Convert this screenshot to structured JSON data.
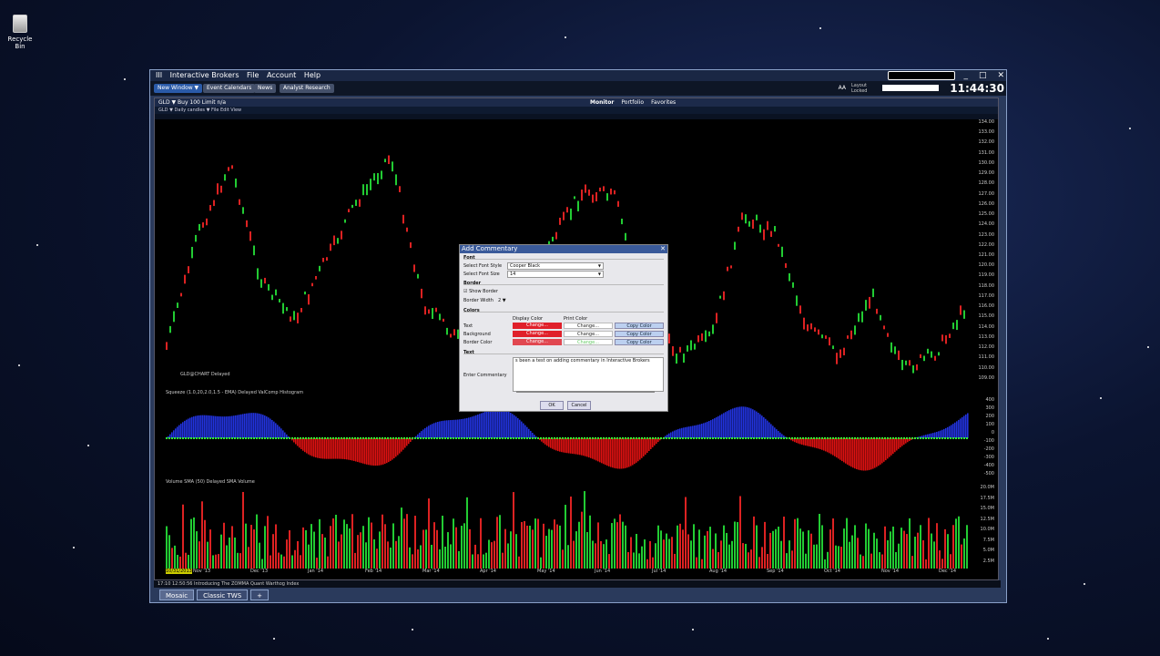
{
  "desktop": {
    "recycle_label": "Recycle Bin"
  },
  "app": {
    "title": "Interactive Brokers",
    "menu": [
      "File",
      "Account",
      "Help"
    ],
    "toolbar_buttons": [
      "New Window ▼",
      "Event Calendars",
      "News",
      "Analyst Research"
    ],
    "aa_label": "AA",
    "layout_lock": "Layout Locked",
    "clock": "11:44:30"
  },
  "chart": {
    "symbol_header": "GLD ▼    Buy 100 Limit n/a",
    "sub_header": "GLD ▼   Daily candles ▼   File   Edit   View",
    "monitor_tabs": [
      "Monitor",
      "Portfolio",
      "Favorites"
    ],
    "gld_label": "GLD@CHART Delayed",
    "osc_header": "Squeeze   (1.0,20,2.0,1.5 - EMA) Delayed     ValComp     Histogram",
    "vol_header": "Volume SMA   (50) Delayed     SMA     Volume",
    "price_ticks": [
      "134.00",
      "133.00",
      "132.00",
      "131.00",
      "130.00",
      "129.00",
      "128.00",
      "127.00",
      "126.00",
      "125.00",
      "124.00",
      "123.00",
      "122.00",
      "121.00",
      "120.00",
      "119.00",
      "118.00",
      "117.00",
      "116.00",
      "115.00",
      "114.00",
      "113.00",
      "112.00",
      "111.00",
      "110.00",
      "109.00"
    ],
    "osc_ticks": [
      "400",
      "300",
      "200",
      "100",
      "0",
      "-100",
      "-200",
      "-300",
      "-400",
      "-500"
    ],
    "vol_ticks": [
      "20.0M",
      "17.5M",
      "15.0M",
      "12.5M",
      "10.0M",
      "7.5M",
      "5.0M",
      "2.5M"
    ],
    "date_ticks": [
      "Nov '13",
      "Dec '13",
      "Jan '14",
      "Feb '14",
      "Mar '14",
      "Apr '14",
      "May '14",
      "Jun '14",
      "Jul '14",
      "Aug '14",
      "Sep '14",
      "Oct '14",
      "Nov '14",
      "Dec '14"
    ],
    "first_date": "10/31/2013"
  },
  "news_ticker": "17:10 12:50:56 Introducing The ZOMMA Quant Warthog Index",
  "bottom_tabs": [
    "Mosaic",
    "Classic TWS"
  ],
  "dialog": {
    "title": "Add Commentary",
    "font_section": "Font",
    "font_style_label": "Select Font Style",
    "font_style_value": "Cooper Black",
    "font_size_label": "Select Font Size",
    "font_size_value": "14",
    "border_section": "Border",
    "show_border": "Show Border",
    "border_width_label": "Border Width",
    "border_width_value": "2",
    "color_section": "Colors",
    "display_color": "Display Color",
    "print_color": "Print Color",
    "rows": [
      {
        "label": "Text",
        "change": "Change...",
        "copy": "Copy Color"
      },
      {
        "label": "Background",
        "change": "Change...",
        "copy": "Copy Color"
      },
      {
        "label": "Border Color",
        "change": "Change...",
        "copy": "Copy Color"
      }
    ],
    "text_section": "Text",
    "enter_commentary": "Enter Commentary",
    "commentary_text": "s been a test on adding commentary in Interactive Brokers",
    "ok": "OK",
    "cancel": "Cancel"
  }
}
